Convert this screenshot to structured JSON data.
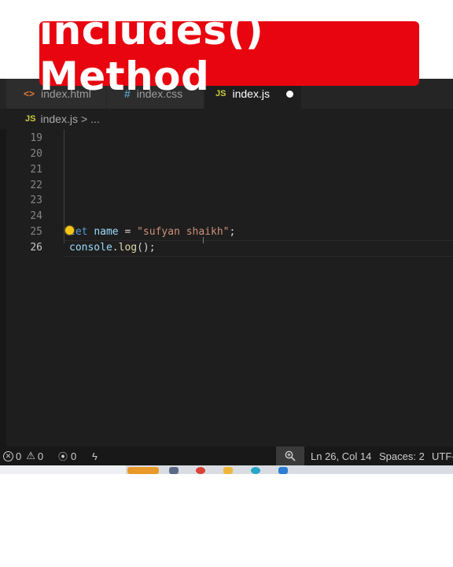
{
  "banner": {
    "title": "includes() Method"
  },
  "tabs": [
    {
      "icon": "<>",
      "label": "index.html",
      "active": false
    },
    {
      "icon": "#",
      "label": "index.css",
      "active": false
    },
    {
      "icon": "JS",
      "label": "index.js",
      "active": true,
      "unsaved": true
    }
  ],
  "breadcrumb": {
    "icon": "JS",
    "file": "index.js",
    "separator": ">",
    "more": "..."
  },
  "line_numbers": [
    "19",
    "20",
    "21",
    "22",
    "23",
    "24",
    "25",
    "26"
  ],
  "current_line": "26",
  "code": {
    "line25": {
      "keyword": "let",
      "variable": "name",
      "operator": " = ",
      "string": "\"sufyan shaikh\"",
      "end": ";"
    },
    "line26": {
      "object": "console",
      "dot": ".",
      "method": "log",
      "rest": "();"
    }
  },
  "status": {
    "errors": "0",
    "warnings": "0",
    "ports": "0",
    "position": "Ln 26, Col 14",
    "spaces": "Spaces: 2",
    "encoding": "UTF-"
  },
  "colors": {
    "banner": "#e8050f",
    "editor_bg": "#1e1e1e",
    "keyword": "#569cd6",
    "variable": "#9cdcfe",
    "string": "#ce9178",
    "function": "#dcdcaa"
  },
  "icons": [
    "html-icon",
    "css-icon",
    "js-icon",
    "lightbulb-icon",
    "error-icon",
    "warning-icon",
    "broadcast-icon",
    "lightning-icon",
    "zoom-icon"
  ]
}
